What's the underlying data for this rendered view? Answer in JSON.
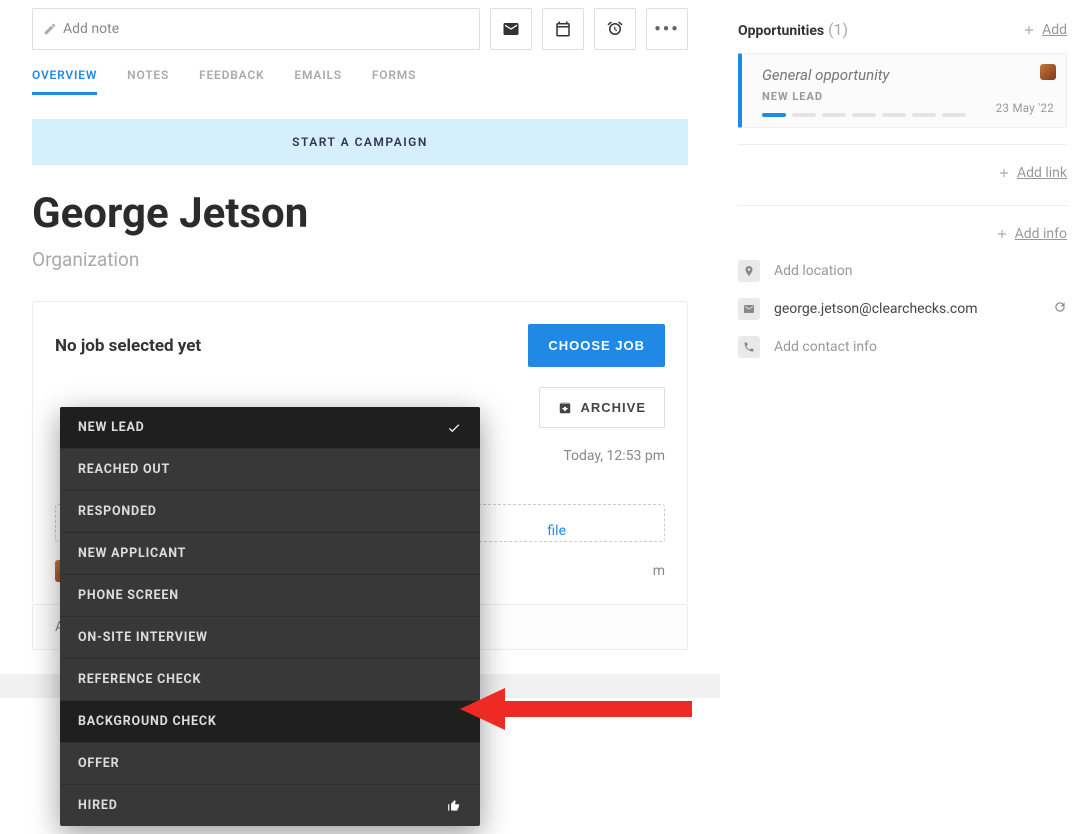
{
  "note_placeholder": "Add note",
  "tabs": {
    "overview": "OVERVIEW",
    "notes": "NOTES",
    "feedback": "FEEDBACK",
    "emails": "EMAILS",
    "forms": "FORMS"
  },
  "campaign_button": "START A CAMPAIGN",
  "person": {
    "name": "George Jetson",
    "org": "Organization"
  },
  "card": {
    "no_job": "No job selected yet",
    "choose_job": "CHOOSE JOB",
    "archive": "ARCHIVE",
    "timestamp": "Today, 12:53 pm",
    "drop_text_prefix": "file",
    "footer_text": "m"
  },
  "below_card_text": "A",
  "stages": {
    "new_lead": "NEW LEAD",
    "reached_out": "REACHED OUT",
    "responded": "RESPONDED",
    "new_applicant": "NEW APPLICANT",
    "phone_screen": "PHONE SCREEN",
    "on_site": "ON-SITE INTERVIEW",
    "reference": "REFERENCE CHECK",
    "background": "BACKGROUND CHECK",
    "offer": "OFFER",
    "hired": "HIRED"
  },
  "sidebar": {
    "opps_title": "Opportunities",
    "opps_count": "(1)",
    "add": "Add",
    "add_link": "Add link",
    "add_info": "Add info",
    "add_location": "Add location",
    "email": "george.jetson@clearchecks.com",
    "add_contact": "Add contact info",
    "opportunity": {
      "title": "General opportunity",
      "stage": "NEW LEAD",
      "date": "23 May '22"
    }
  }
}
